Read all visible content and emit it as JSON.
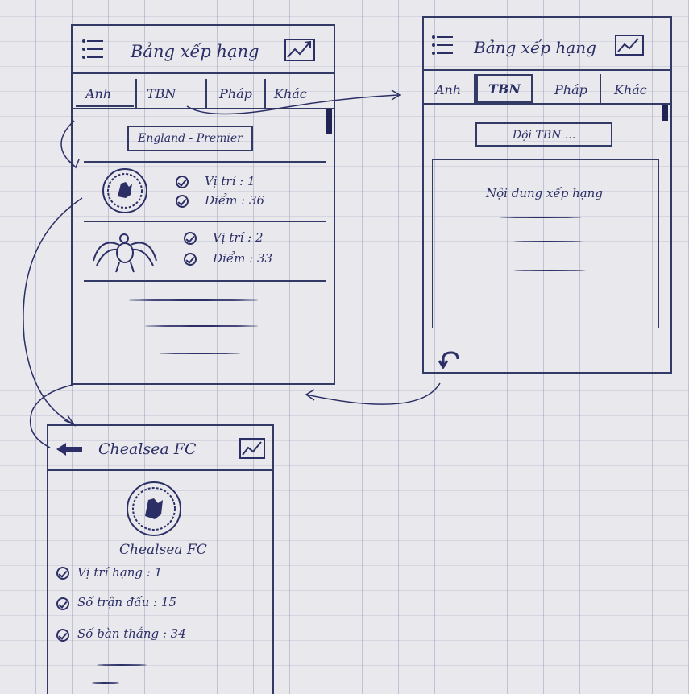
{
  "screen_ranking": {
    "title": "Bảng xếp hạng",
    "tabs": [
      "Anh",
      "TBN",
      "Pháp",
      "Khác"
    ],
    "league_button": "England - Premier",
    "teams": [
      {
        "position": "Vị trí : 1",
        "points": "Điểm : 36"
      },
      {
        "position": "Vị trí : 2",
        "points": "Điểm : 33"
      }
    ]
  },
  "screen_spain": {
    "title": "Bảng xếp hạng",
    "tabs": [
      "Anh",
      "TBN",
      "Pháp",
      "Khác"
    ],
    "league_button": "Đội TBN ...",
    "content_label": "Nội dung xếp hạng"
  },
  "screen_club": {
    "title": "Chealsea FC",
    "club_name": "Chealsea FC",
    "stats": [
      "Vị trí hạng : 1",
      "Số trận đấu : 15",
      "Số bàn thắng : 34"
    ]
  },
  "icons": [
    "menu-icon",
    "chart-icon",
    "back-arrow-icon",
    "undo-icon",
    "club-crest-icon",
    "eagle-crest-icon",
    "check-icon"
  ],
  "colors": {
    "ink": "#2b2f66",
    "paper": "#e9e8ec"
  }
}
